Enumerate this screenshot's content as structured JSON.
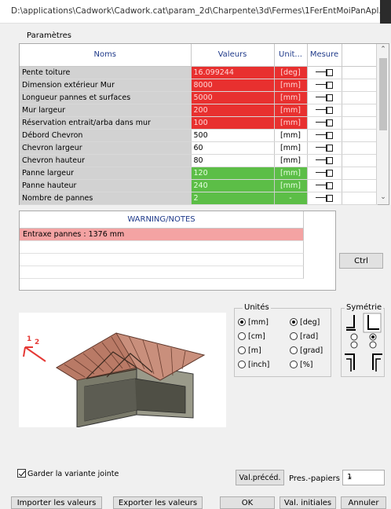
{
  "window": {
    "title": "D:\\applications\\Cadwork\\Cadwork.cat\\param_2d\\Charpente\\3d\\Fermes\\1FerEntMoiPanApl..."
  },
  "params_label": "Paramètres",
  "table": {
    "headers": {
      "name": "Noms",
      "value": "Valeurs",
      "unit": "Unit...",
      "measure": "Mesure"
    },
    "rows": [
      {
        "name": "Pente toiture",
        "value": "16.099244",
        "unit": "[deg]",
        "status": "red"
      },
      {
        "name": "Dimension extérieur Mur",
        "value": "8000",
        "unit": "[mm]",
        "status": "red"
      },
      {
        "name": "Longueur pannes et surfaces",
        "value": "5000",
        "unit": "[mm]",
        "status": "red"
      },
      {
        "name": "Mur largeur",
        "value": "200",
        "unit": "[mm]",
        "status": "red"
      },
      {
        "name": "Réservation entrait/arba dans mur",
        "value": "100",
        "unit": "[mm]",
        "status": "red"
      },
      {
        "name": "Débord Chevron",
        "value": "500",
        "unit": "[mm]",
        "status": "none"
      },
      {
        "name": "Chevron largeur",
        "value": "60",
        "unit": "[mm]",
        "status": "none"
      },
      {
        "name": "Chevron hauteur",
        "value": "80",
        "unit": "[mm]",
        "status": "none"
      },
      {
        "name": "Panne largeur",
        "value": "120",
        "unit": "[mm]",
        "status": "green"
      },
      {
        "name": "Panne hauteur",
        "value": "240",
        "unit": "[mm]",
        "status": "green"
      },
      {
        "name": "Nombre de pannes",
        "value": "2",
        "unit": "-",
        "status": "green"
      }
    ]
  },
  "warnings": {
    "header": "WARNING/NOTES",
    "rows": [
      "Entraxe pannes : 1376 mm"
    ]
  },
  "buttons": {
    "ctrl": "Ctrl",
    "val_preced": "Val.précéd.",
    "import": "Importer les valeurs",
    "export": "Exporter les valeurs",
    "ok": "OK",
    "val_initiales": "Val. initiales",
    "annuler": "Annuler"
  },
  "units": {
    "legend": "Unités",
    "length": [
      {
        "label": "[mm]",
        "selected": true
      },
      {
        "label": "[cm]",
        "selected": false
      },
      {
        "label": "[m]",
        "selected": false
      },
      {
        "label": "[inch]",
        "selected": false
      }
    ],
    "angle": [
      {
        "label": "[deg]",
        "selected": true
      },
      {
        "label": "[rad]",
        "selected": false
      },
      {
        "label": "[grad]",
        "selected": false
      },
      {
        "label": "[%]",
        "selected": false
      }
    ]
  },
  "symmetry": {
    "legend": "Symétrie"
  },
  "options": {
    "keep_variant": "Garder la variante jointe",
    "clipboard_label": "Pres.-papiers",
    "clipboard_value": "1"
  },
  "colors": {
    "red": "#e8302f",
    "green": "#5cbe47",
    "header_text": "#1f3a8a",
    "warning_highlight": "#f4a3a3"
  }
}
